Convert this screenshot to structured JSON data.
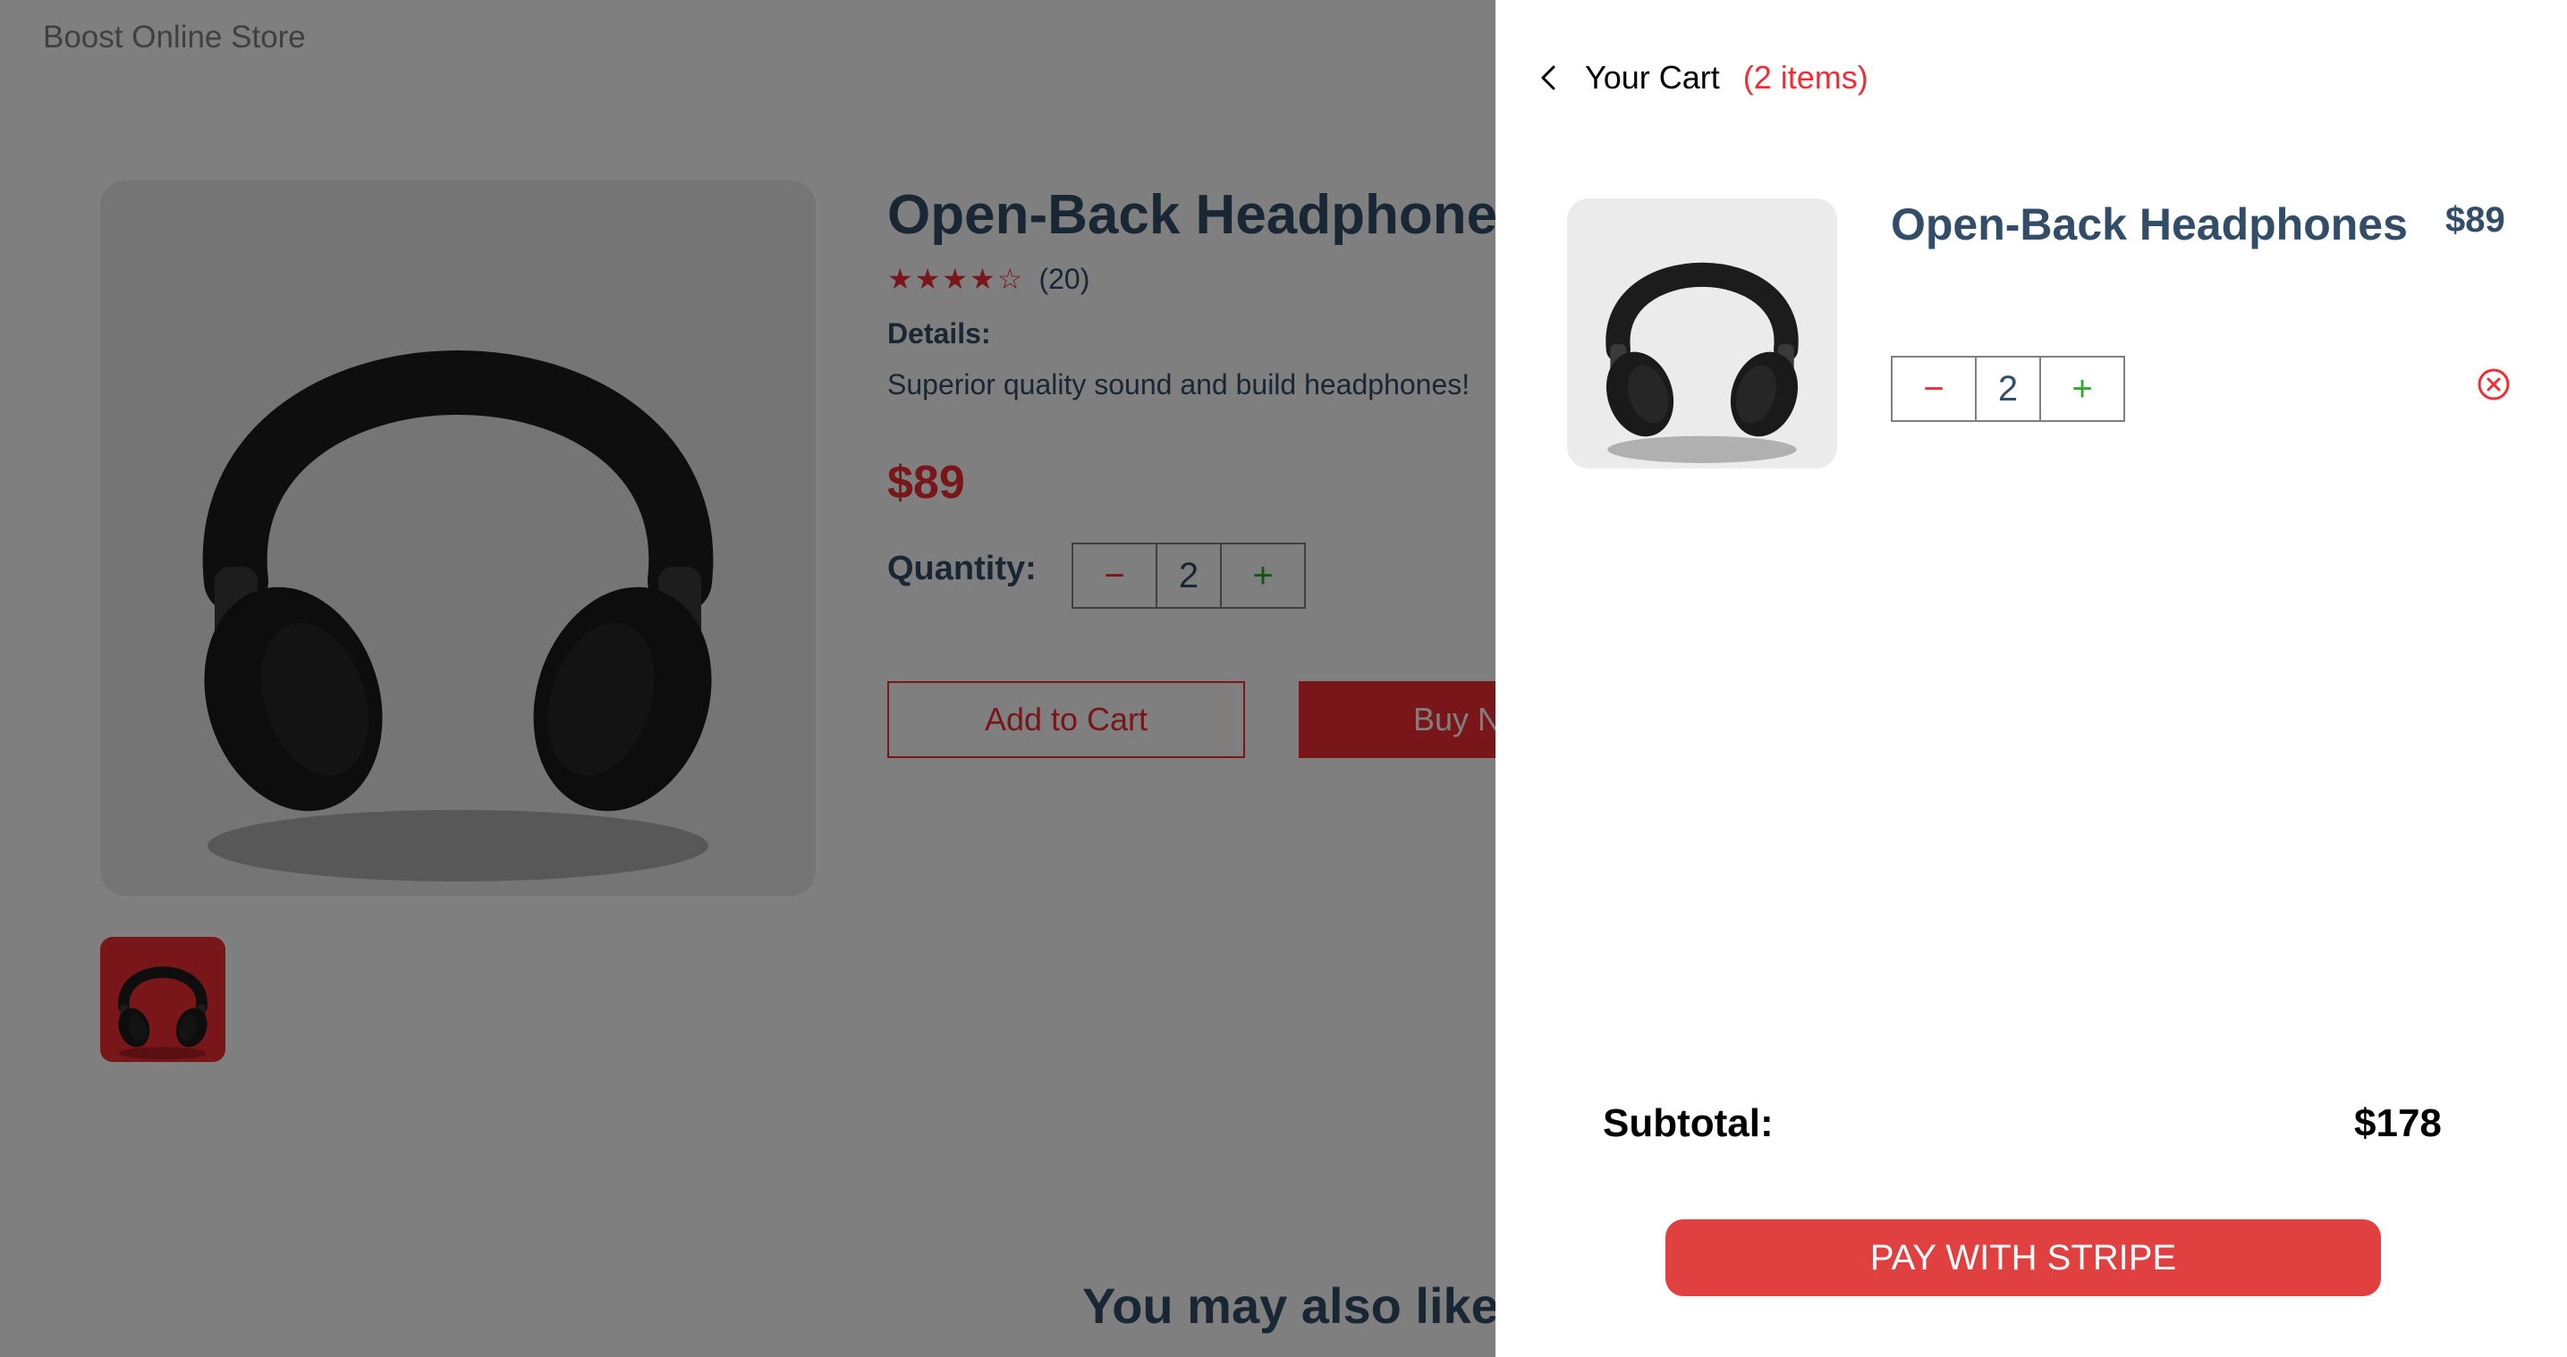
{
  "store": {
    "name": "Boost Online Store"
  },
  "product": {
    "title": "Open-Back Headphones",
    "rating": 4,
    "rating_max": 5,
    "stars": "★★★★☆",
    "review_count": "(20)",
    "details_label": "Details:",
    "details_text": "Superior quality sound and build headphones!",
    "price": "$89",
    "quantity_label": "Quantity:",
    "quantity": "2",
    "minus": "−",
    "plus": "+",
    "add_to_cart": "Add to Cart",
    "buy_now": "Buy Now"
  },
  "related": {
    "heading": "You may also like"
  },
  "cart": {
    "title": "Your Cart",
    "count": "(2 items)",
    "item": {
      "name": "Open-Back Headphones",
      "price": "$89",
      "quantity": "2",
      "minus": "−",
      "plus": "+"
    },
    "subtotal_label": "Subtotal:",
    "subtotal_value": "$178",
    "pay_button": "PAY WITH STRIPE"
  },
  "colors": {
    "accent": "#f02d34",
    "text_dark": "#324d67",
    "pay_button": "#e0403f",
    "plus": "#31a831"
  },
  "icons": [
    "chevron-left-icon",
    "remove-circle-icon",
    "star-icon"
  ]
}
